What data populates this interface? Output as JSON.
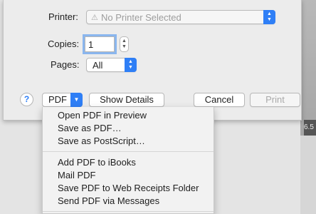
{
  "dialog": {
    "printer_label": "Printer:",
    "printer_value": "No Printer Selected",
    "copies_label": "Copies:",
    "copies_value": "1",
    "pages_label": "Pages:",
    "pages_value": "All"
  },
  "buttons": {
    "help": "?",
    "pdf": "PDF",
    "show_details": "Show Details",
    "cancel": "Cancel",
    "print": "Print"
  },
  "pdf_menu": {
    "group1": [
      "Open PDF in Preview",
      "Save as PDF…",
      "Save as PostScript…"
    ],
    "group2": [
      "Add PDF to iBooks",
      "Mail PDF",
      "Save PDF to Web Receipts Folder",
      "Send PDF via Messages"
    ]
  },
  "background": {
    "peek_text": "6.5"
  },
  "colors": {
    "accent": "#2f7ff6",
    "focus_ring": "#8ab6ee"
  }
}
